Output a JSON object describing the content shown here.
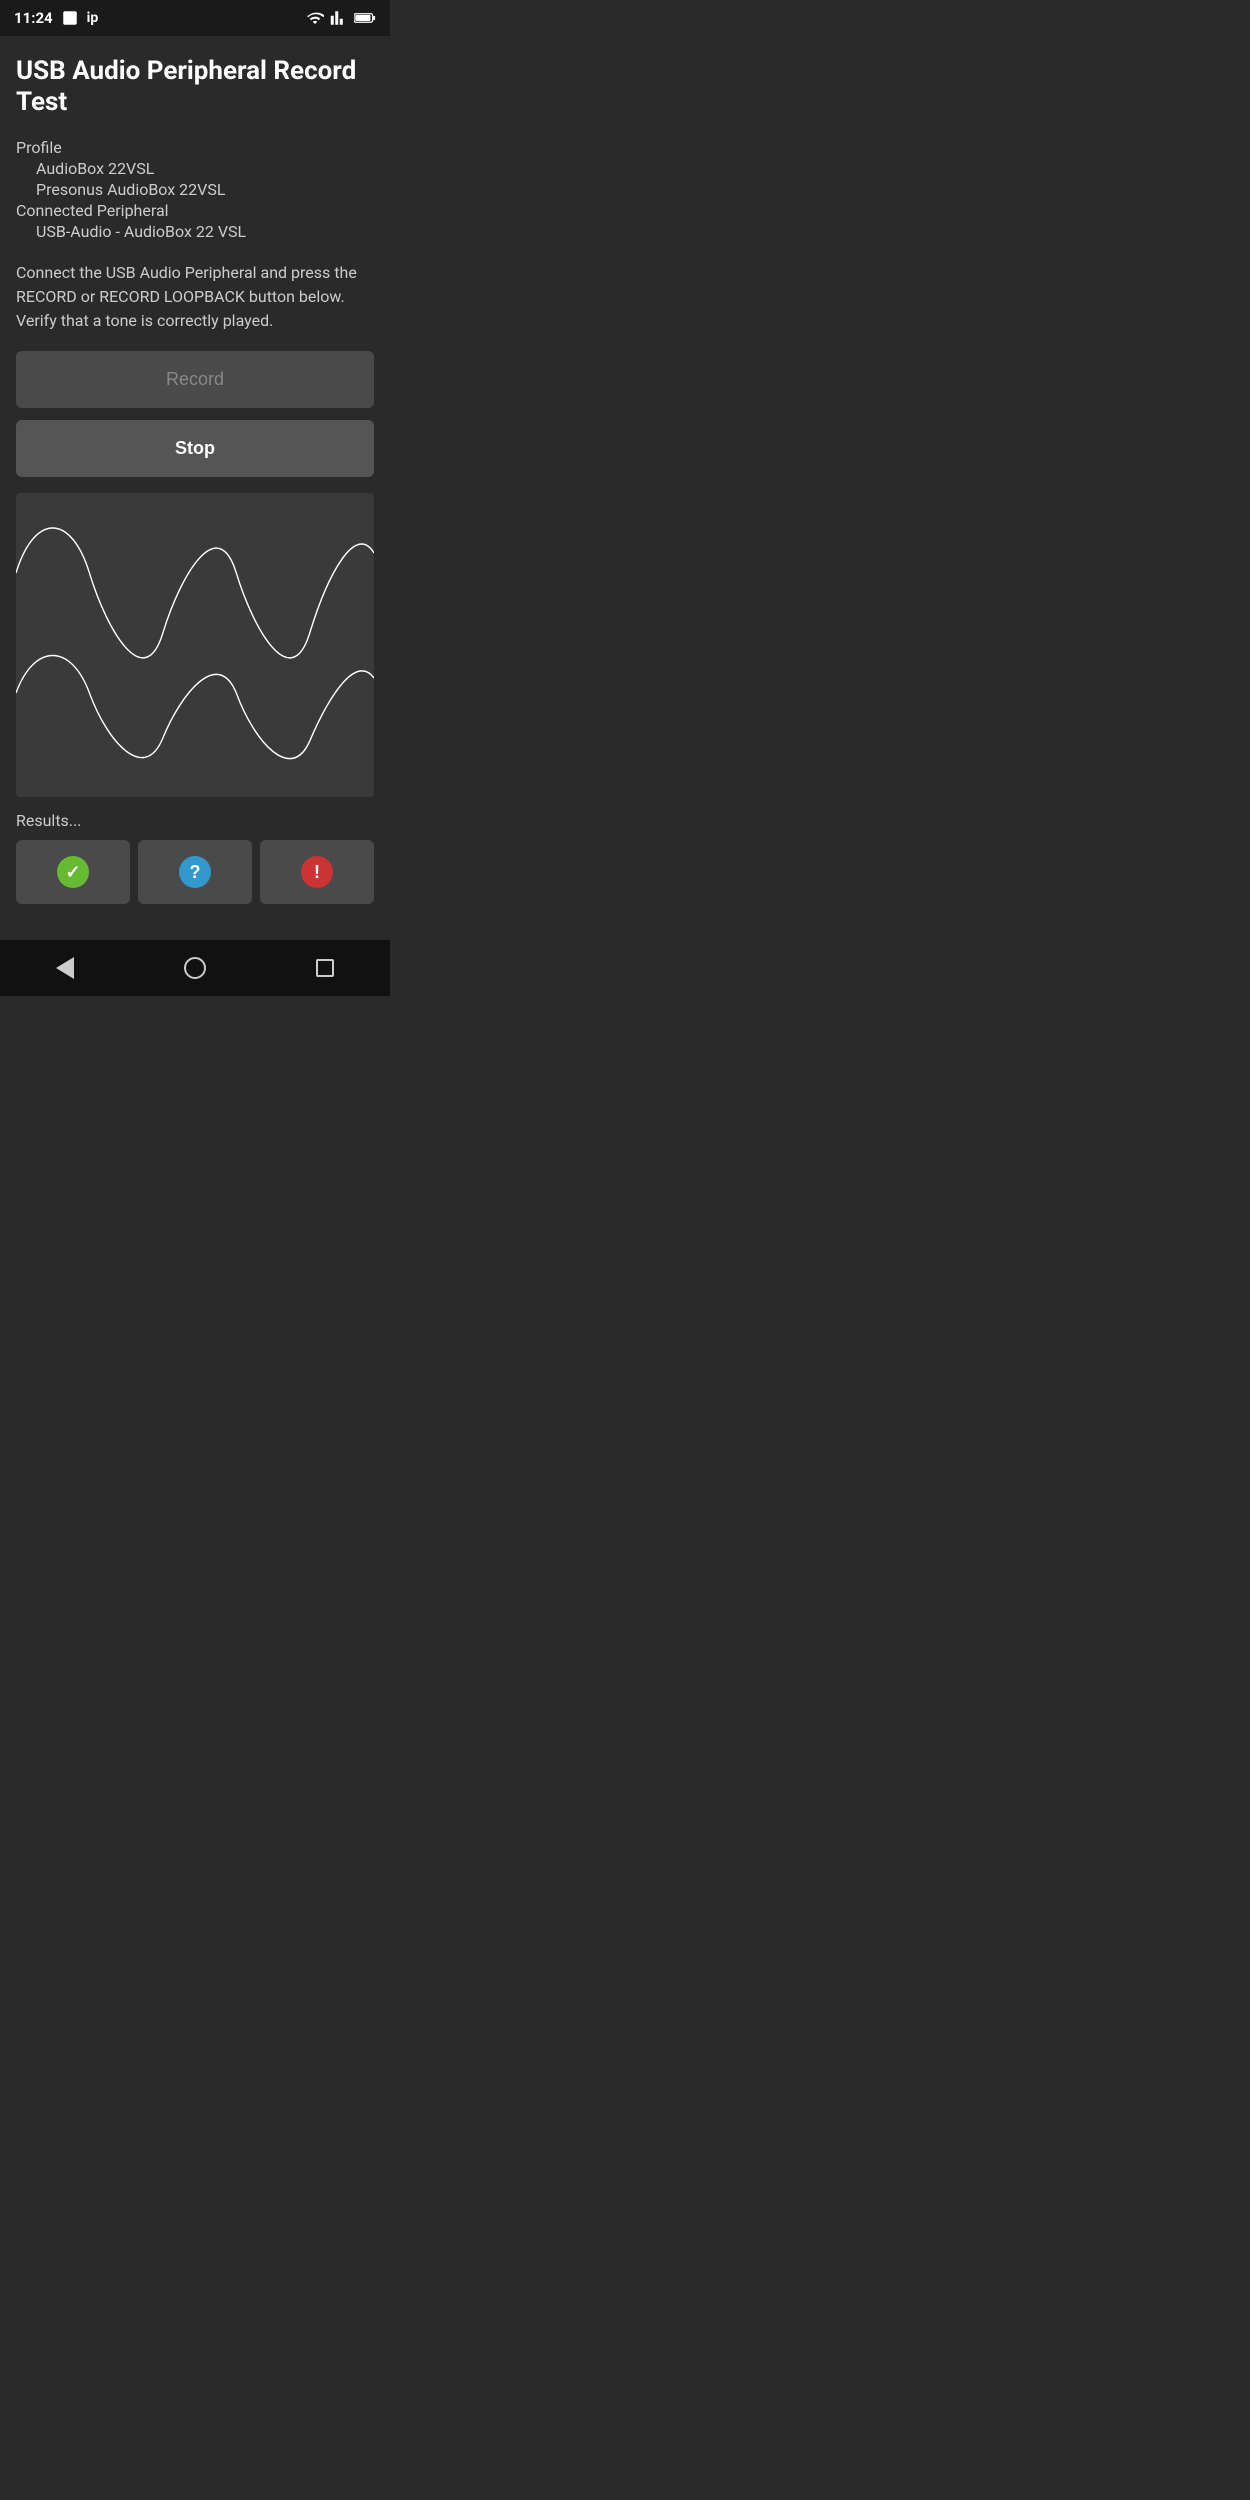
{
  "statusBar": {
    "time": "11:24",
    "icons": [
      "photo",
      "ip",
      "wifi",
      "signal",
      "battery"
    ]
  },
  "page": {
    "title": "USB Audio Peripheral Record Test",
    "profile": {
      "label": "Profile",
      "line1": "AudioBox 22VSL",
      "line2": "Presonus AudioBox 22VSL"
    },
    "connectedPeripheral": {
      "label": "Connected Peripheral",
      "value": "USB-Audio - AudioBox 22 VSL"
    },
    "instruction": "Connect the USB Audio Peripheral and press the RECORD or RECORD LOOPBACK button below. Verify that a tone is correctly played.",
    "recordButton": "Record",
    "stopButton": "Stop",
    "resultsLabel": "Results...",
    "resultButtons": [
      {
        "type": "checkmark",
        "color": "green",
        "symbol": "✓"
      },
      {
        "type": "question",
        "color": "blue",
        "symbol": "?"
      },
      {
        "type": "exclamation",
        "color": "red",
        "symbol": "!"
      }
    ]
  },
  "navBar": {
    "back": "back",
    "home": "home",
    "recents": "recents"
  }
}
